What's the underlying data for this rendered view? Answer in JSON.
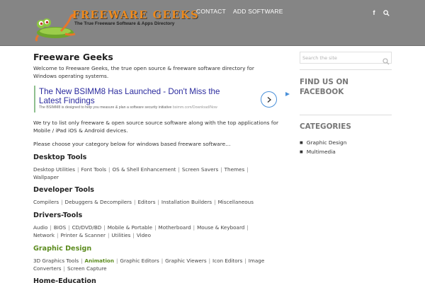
{
  "header": {
    "logo_title": "FREEWARE GEEKS",
    "logo_tagline": "The True Freeware Software & Apps Directory",
    "nav": [
      {
        "label": "CONTACT"
      },
      {
        "label": "ADD SOFTWARE"
      }
    ],
    "icons": [
      "facebook-icon",
      "search-icon"
    ],
    "bg_color": "#858585",
    "logo_color": "#ee8a1c"
  },
  "main": {
    "title": "Freeware Geeks",
    "intro": "Welcome to Freeware Geeks, the true open source & freeware software directory for Windows operating systems.",
    "ad": {
      "headline": "The New BSIMM8 Has Launched - Don't Miss the Latest Findings",
      "description": "The BSIMM8 is designed to help you measure & plan a software security initiative",
      "url": "bsimm.com/Download/Now"
    },
    "paragraph2": "We try to list only freeware & open source source software along with the top applications for Mobile / iPad iOS & Android devices.",
    "paragraph3": "Please choose your category below for windows based freeware software…",
    "categories": [
      {
        "title": "Desktop Tools",
        "links": [
          "Desktop Utilities",
          "Font Tools",
          "OS & Shell Enhancement",
          "Screen Savers",
          "Themes",
          "Wallpaper"
        ]
      },
      {
        "title": "Developer Tools",
        "links": [
          "Compilers",
          "Debuggers & Decompilers",
          "Editors",
          "Installation Builders",
          "Miscellaneous"
        ]
      },
      {
        "title": "Drivers-Tools",
        "links": [
          "Audio",
          "BIOS",
          "CD/DVD/BD",
          "Mobile & Portable",
          "Motherboard",
          "Mouse & Keyboard",
          "Network",
          "Printer & Scanner",
          "Utilities",
          "Video"
        ]
      },
      {
        "title": "Graphic Design",
        "links": [
          "3D Graphics Tools",
          "Animation",
          "Graphic Editors",
          "Graphic Viewers",
          "Icon Editors",
          "Image Converters",
          "Screen Capture"
        ]
      },
      {
        "title": "Home-Education",
        "links": []
      }
    ],
    "accent_color": "#5c8c1f"
  },
  "sidebar": {
    "search_placeholder": "Search the site",
    "find_us": "FIND US ON FACEBOOK",
    "categories_title": "CATEGORIES",
    "categories": [
      "Graphic Design",
      "Multimedia"
    ]
  }
}
